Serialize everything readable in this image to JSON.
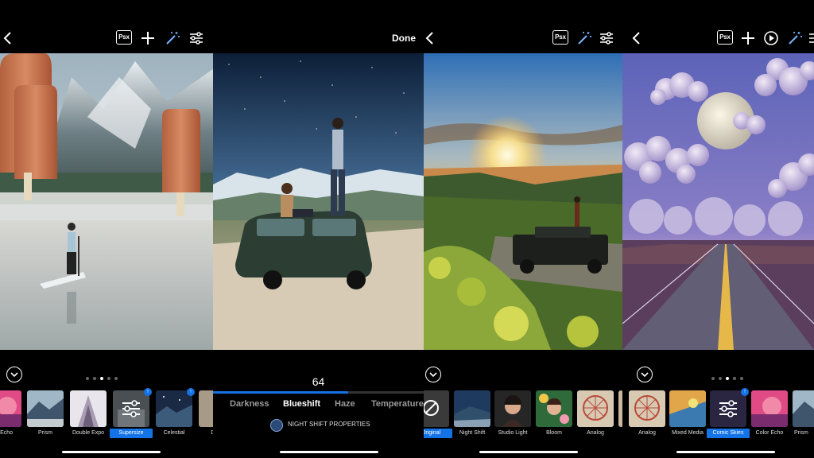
{
  "colors": {
    "accent": "#1473e6",
    "background": "#000000",
    "inactive_text": "#9a9a9a"
  },
  "panel1": {
    "psx_label": "Psx",
    "pagination": {
      "count": 5,
      "active": 2
    },
    "looks": [
      {
        "label": "or Echo",
        "selected": false,
        "premium": false
      },
      {
        "label": "Prism",
        "selected": false,
        "premium": false
      },
      {
        "label": "Double Expo",
        "selected": false,
        "premium": false
      },
      {
        "label": "Supersize",
        "selected": true,
        "premium": true
      },
      {
        "label": "Celestial",
        "selected": false,
        "premium": true
      },
      {
        "label": "Drea",
        "selected": false,
        "premium": false
      }
    ]
  },
  "panel2": {
    "done_label": "Done",
    "slider_value": "64",
    "slider_fill_percent": 64,
    "tabs": [
      {
        "label": "Darkness",
        "active": false
      },
      {
        "label": "Blueshift",
        "active": true
      },
      {
        "label": "Haze",
        "active": false
      },
      {
        "label": "Temperature",
        "active": false
      }
    ],
    "properties_label": "NIGHT SHIFT PROPERTIES"
  },
  "panel3": {
    "psx_label": "Psx",
    "looks": [
      {
        "label": "Original",
        "selected": true
      },
      {
        "label": "Night Shift",
        "selected": false
      },
      {
        "label": "Studio Light",
        "selected": false
      },
      {
        "label": "Bloom",
        "selected": false
      },
      {
        "label": "Analog",
        "selected": false
      }
    ]
  },
  "panel4": {
    "psx_label": "Psx",
    "pagination": {
      "count": 5,
      "active": 2
    },
    "looks": [
      {
        "label": "Analog",
        "selected": false,
        "premium": false
      },
      {
        "label": "Mixed Media",
        "selected": false,
        "premium": false
      },
      {
        "label": "Comic Skies",
        "selected": true,
        "premium": true
      },
      {
        "label": "Color Echo",
        "selected": false,
        "premium": false
      },
      {
        "label": "Prism",
        "selected": false,
        "premium": false
      }
    ]
  }
}
